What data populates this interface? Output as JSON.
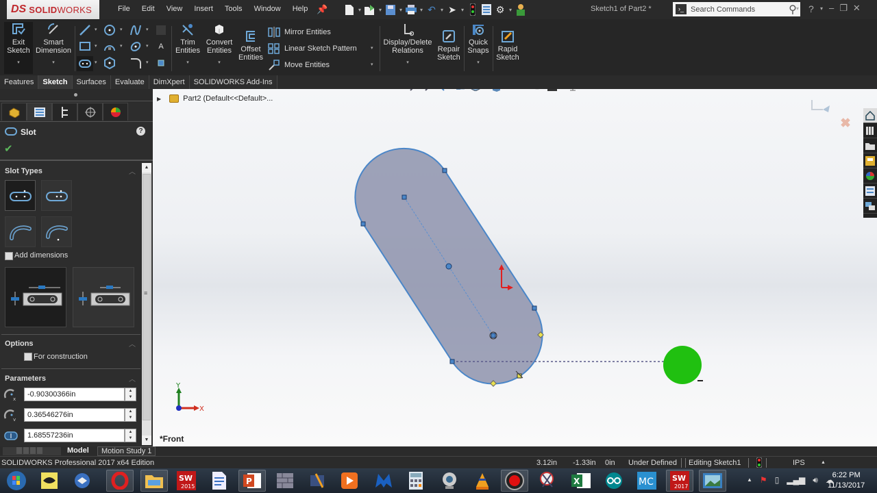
{
  "app": {
    "logo_ds": "DS",
    "logo_solid": "SOLID",
    "logo_works": "WORKS",
    "document_title": "Sketch1 of Part2 *",
    "menu": [
      "File",
      "Edit",
      "View",
      "Insert",
      "Tools",
      "Window",
      "Help"
    ],
    "quick_access": [
      "new-icon",
      "open-icon",
      "save-icon",
      "print-icon",
      "undo-icon",
      "select-icon",
      "rebuild-icon",
      "file-properties-icon",
      "options-icon",
      "user-icon"
    ],
    "search": {
      "placeholder": "Search Commands"
    },
    "help_label": "?"
  },
  "command_manager": {
    "exit_sketch": "Exit Sketch",
    "smart_dimension": "Smart Dimension",
    "trim_entities": "Trim Entities",
    "convert_entities": "Convert Entities",
    "offset_entities": "Offset Entities",
    "mirror_entities": "Mirror Entities",
    "linear_sketch_pattern": "Linear Sketch Pattern",
    "move_entities": "Move Entities",
    "display_delete_relations": "Display/Delete Relations",
    "repair_sketch": "Repair Sketch",
    "quick_snaps": "Quick Snaps",
    "rapid_sketch": "Rapid Sketch",
    "sketch_tools": [
      "line-icon",
      "circle-icon",
      "spline-icon",
      "plane-icon",
      "rectangle-icon",
      "arc-icon",
      "ellipse-icon",
      "text-icon",
      "slot-icon",
      "polygon-icon",
      "fillet-icon",
      "point-icon"
    ]
  },
  "tabs": [
    {
      "label": "Features",
      "active": false
    },
    {
      "label": "Sketch",
      "active": true
    },
    {
      "label": "Surfaces",
      "active": false
    },
    {
      "label": "Evaluate",
      "active": false
    },
    {
      "label": "DimXpert",
      "active": false
    },
    {
      "label": "SOLIDWORKS Add-Ins",
      "active": false
    }
  ],
  "feature_tree": {
    "root": "Part2  (Default<<Default>..."
  },
  "property_manager": {
    "title": "Slot",
    "help": "?",
    "ok": "✔",
    "slot_types": {
      "title": "Slot Types",
      "buttons": [
        "straight-slot",
        "centerpoint-straight-slot",
        "3-point-arc-slot",
        "centerpoint-arc-slot"
      ],
      "selected": 0
    },
    "add_dimensions": {
      "label": "Add dimensions",
      "checked": false
    },
    "dimension_styles": {
      "selected": 0
    },
    "options": {
      "title": "Options",
      "for_construction": {
        "label": "For construction",
        "checked": false
      }
    },
    "parameters": {
      "title": "Parameters",
      "fields": [
        {
          "name": "center-x",
          "value": "-0.90300366in"
        },
        {
          "name": "center-y",
          "value": "0.36546276in"
        },
        {
          "name": "slot-length",
          "value": "1.68557236in"
        }
      ]
    }
  },
  "graphics": {
    "view_label": "*Front",
    "triad": {
      "x": "X",
      "y": "Y"
    },
    "heads_up_tools": [
      "zoom-to-fit-icon",
      "zoom-to-area-icon",
      "previous-view-icon",
      "section-view-icon",
      "view-orientation-icon",
      "display-style-icon",
      "hide-show-items-icon",
      "edit-appearance-icon",
      "apply-scene-icon",
      "view-settings-icon"
    ]
  },
  "bottom_tabs": [
    {
      "label": "Model",
      "active": true
    },
    {
      "label": "Motion Study 1",
      "active": false
    }
  ],
  "status_bar": {
    "edition": "SOLIDWORKS Professional 2017 x64 Edition",
    "x": "3.12in",
    "y": "-1.33in",
    "z": "0in",
    "state": "Under Defined",
    "mode": "Editing Sketch1",
    "units": "IPS",
    "units_arrow": "▲"
  },
  "taskbar": {
    "items": [
      "start-button",
      "batch-app",
      "thunderbird",
      "opera",
      "file-explorer",
      "solidworks-2015",
      "document-viewer",
      "powerpoint",
      "wall-app",
      "media-app",
      "media-player",
      "malwarebytes",
      "calculator",
      "webcam",
      "vlc-app",
      "recorder",
      "snipping-tool",
      "excel",
      "arduino",
      "mc-app",
      "solidworks-2017",
      "photo-viewer"
    ],
    "time": "6:22 PM",
    "date": "11/13/2017"
  }
}
